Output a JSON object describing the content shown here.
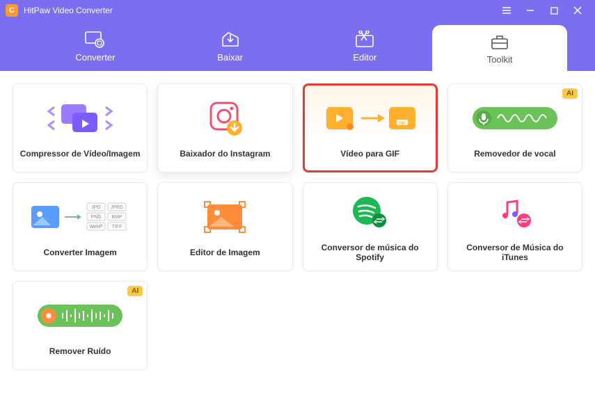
{
  "app": {
    "title": "HitPaw Video Converter"
  },
  "nav": {
    "converter": "Converter",
    "baixar": "Baixar",
    "editor": "Editor",
    "toolkit": "Toolkit"
  },
  "cards": {
    "compressor": "Compressor de Vídeo/Imagem",
    "instagram": "Baixador do Instagram",
    "videogif": "Vídeo para GIF",
    "vocal": "Removedor de vocal",
    "convimg": "Converter Imagem",
    "editimg": "Editor de Imagem",
    "spotify": "Conversor de música do Spotify",
    "itunes": "Conversor de Música do iTunes",
    "ruido": "Remover Ruído"
  },
  "badges": {
    "ai": "AI"
  },
  "formats": {
    "jpg": "JPG",
    "jpeg": "JPEG",
    "png": "PNG",
    "bmp": "BMP",
    "webp": "WebP",
    "tiff": "TIFF"
  }
}
